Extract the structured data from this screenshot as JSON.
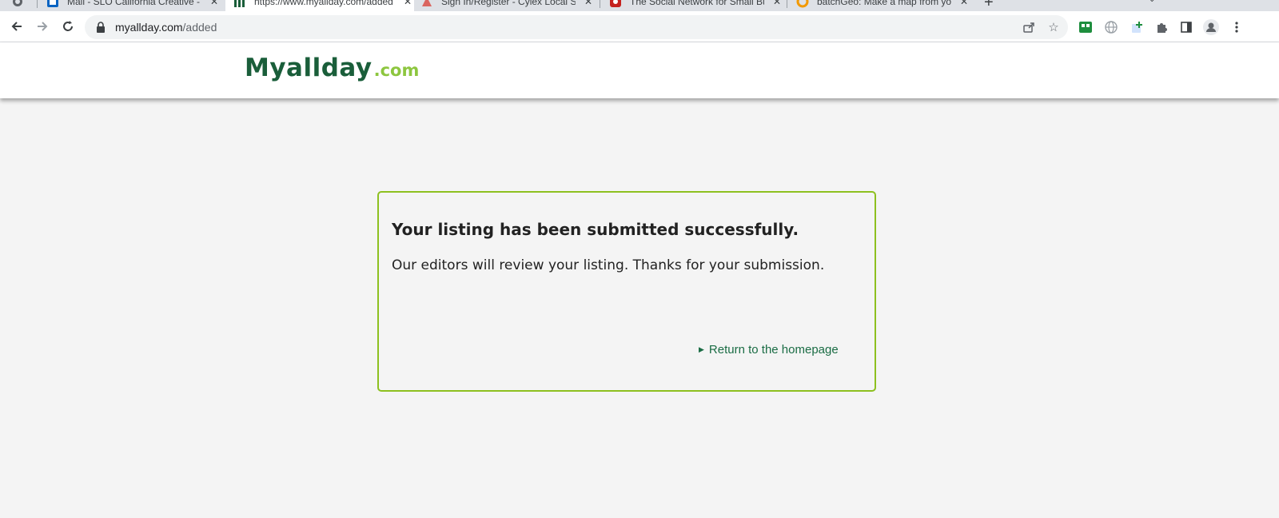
{
  "browser": {
    "tabs": [
      {
        "title": "Mail - SLO California Creative - O",
        "favicon": "outlook-icon",
        "active": false
      },
      {
        "title": "https://www.myallday.com/added",
        "favicon": "myallday-icon",
        "active": true
      },
      {
        "title": "Sign In/Register - Cylex Local Sea",
        "favicon": "cylex-icon",
        "active": false
      },
      {
        "title": "The Social Network for Small Bus",
        "favicon": "social-network-icon",
        "active": false
      },
      {
        "title": "batchGeo: Make a map from your",
        "favicon": "batchgeo-icon",
        "active": false
      }
    ],
    "new_tab_label": "+",
    "close_glyph": "✕",
    "url_host": "myallday.com",
    "url_path": "/added"
  },
  "site": {
    "logo_main": "Myallday",
    "logo_tld": ".com",
    "colors": {
      "brand_green": "#1a5e3a",
      "accent_lime": "#8dc63f",
      "box_border": "#8dc01f"
    }
  },
  "message": {
    "title": "Your listing has been submitted successfully.",
    "body": "Our editors will review your listing. Thanks for your submission.",
    "link_label": "Return to the homepage"
  }
}
